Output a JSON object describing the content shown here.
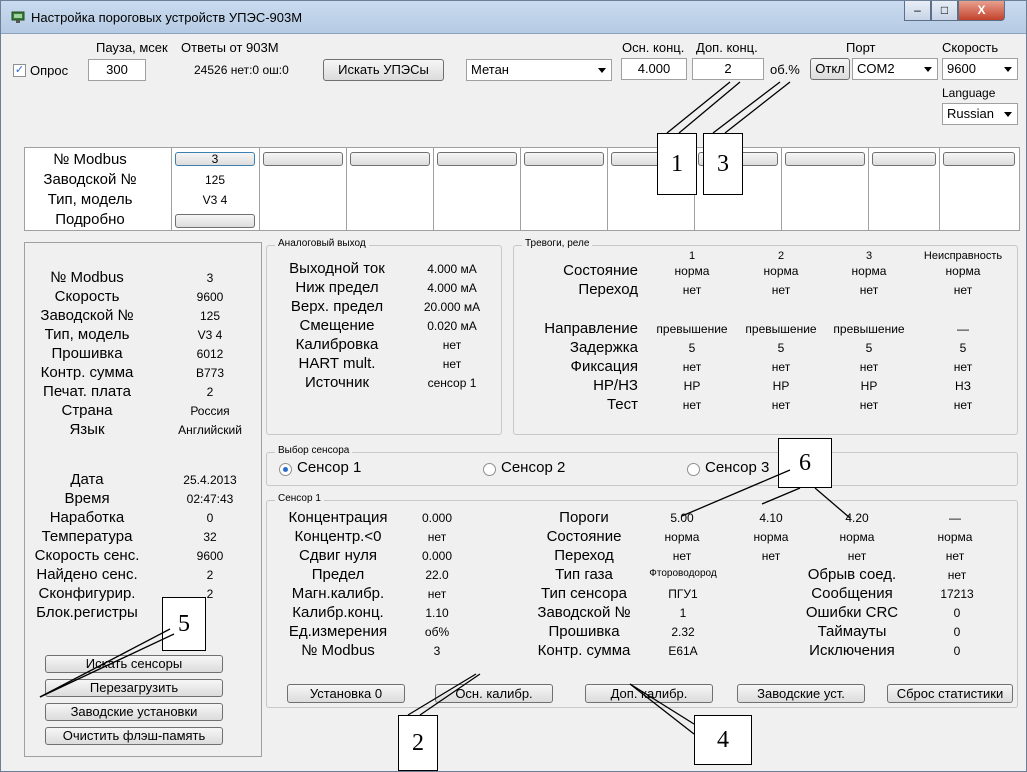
{
  "window": {
    "title": "Настройка пороговых устройств УПЭС-903М"
  },
  "toolbar": {
    "poll_label": "Опрос",
    "pause_label": "Пауза, мсек",
    "pause_value": "300",
    "answers_label": "Ответы от 903М",
    "answers_value": "24526 нет:0 ош:0",
    "search_button": "Искать УПЭСы",
    "gas_select": "Метан",
    "main_conc_label": "Осн. конц.",
    "main_conc_value": "4.000",
    "add_conc_label": "Доп. конц.",
    "add_conc_value": "2",
    "unit": "об.%",
    "off_button": "Откл",
    "port_label": "Порт",
    "port_value": "COM2",
    "speed_label": "Скорость",
    "speed_value": "9600",
    "language_label": "Language",
    "language_value": "Russian"
  },
  "devices": {
    "labels": [
      "№ Modbus",
      "Заводской №",
      "Тип, модель",
      "Подробно"
    ],
    "first": {
      "modbus": "3",
      "serial": "125",
      "model": "V3 4"
    }
  },
  "info": {
    "rows": [
      {
        "label": "№ Modbus",
        "value": "3"
      },
      {
        "label": "Скорость",
        "value": "9600"
      },
      {
        "label": "Заводской №",
        "value": "125"
      },
      {
        "label": "Тип, модель",
        "value": "V3 4"
      },
      {
        "label": "Прошивка",
        "value": "6012"
      },
      {
        "label": "Контр. сумма",
        "value": "B773"
      },
      {
        "label": "Печат. плата",
        "value": "2"
      },
      {
        "label": "Страна",
        "value": "Россия"
      },
      {
        "label": "Язык",
        "value": "Английский"
      }
    ],
    "rows2": [
      {
        "label": "Дата",
        "value": "25.4.2013"
      },
      {
        "label": "Время",
        "value": "02:47:43"
      },
      {
        "label": "Наработка",
        "value": "0"
      },
      {
        "label": "Температура",
        "value": "32"
      },
      {
        "label": "Скорость сенс.",
        "value": "9600"
      },
      {
        "label": "Найдено сенс.",
        "value": "2"
      },
      {
        "label": "Сконфигурир.",
        "value": "2"
      },
      {
        "label": "Блок.регистры",
        "value": ""
      }
    ],
    "buttons": [
      "Искать сенсоры",
      "Перезагрузить",
      "Заводские установки",
      "Очистить флэш-память"
    ]
  },
  "analog": {
    "legend": "Аналоговый выход",
    "rows": [
      {
        "label": "Выходной ток",
        "value": "4.000 мА"
      },
      {
        "label": "Ниж предел",
        "value": "4.000 мА"
      },
      {
        "label": "Верх. предел",
        "value": "20.000 мА"
      },
      {
        "label": "Смещение",
        "value": "0.020 мА"
      },
      {
        "label": "Калибровка",
        "value": "нет"
      },
      {
        "label": "HART mult.",
        "value": "нет"
      },
      {
        "label": "Источник",
        "value": "сенсор 1"
      }
    ]
  },
  "alarms": {
    "legend": "Тревоги, реле",
    "headers": [
      "1",
      "2",
      "3",
      "Неисправность"
    ],
    "rows": [
      {
        "label": "Состояние",
        "values": [
          "норма",
          "норма",
          "норма",
          "норма"
        ]
      },
      {
        "label": "Переход",
        "values": [
          "нет",
          "нет",
          "нет",
          "нет"
        ]
      },
      {
        "label": "Направление",
        "values": [
          "превышение",
          "превышение",
          "превышение",
          "—"
        ]
      },
      {
        "label": "Задержка",
        "values": [
          "5",
          "5",
          "5",
          "5"
        ]
      },
      {
        "label": "Фиксация",
        "values": [
          "нет",
          "нет",
          "нет",
          "нет"
        ]
      },
      {
        "label": "НР/НЗ",
        "values": [
          "НР",
          "НР",
          "НР",
          "НЗ"
        ]
      },
      {
        "label": "Тест",
        "values": [
          "нет",
          "нет",
          "нет",
          "нет"
        ]
      }
    ]
  },
  "sensor_select": {
    "legend": "Выбор сенсора",
    "options": [
      "Сенсор 1",
      "Сенсор 2",
      "Сенсор 3"
    ]
  },
  "sensor1": {
    "legend": "Сенсор 1",
    "left": [
      {
        "label": "Концентрация",
        "value": "0.000"
      },
      {
        "label": "Концентр.<0",
        "value": "нет"
      },
      {
        "label": "Сдвиг нуля",
        "value": "0.000"
      },
      {
        "label": "Предел",
        "value": "22.0"
      },
      {
        "label": "Магн.калибр.",
        "value": "нет"
      },
      {
        "label": "Калибр.конц.",
        "value": "1.10"
      },
      {
        "label": "Ед.измерения",
        "value": "об%"
      },
      {
        "label": "№ Modbus",
        "value": "3"
      }
    ],
    "thresholds_label": "Пороги",
    "thresholds": [
      "5.00",
      "4.10",
      "4.20",
      "—"
    ],
    "state_label": "Состояние",
    "state": [
      "норма",
      "норма",
      "норма",
      "норма"
    ],
    "transition_label": "Переход",
    "transition": [
      "нет",
      "нет",
      "нет",
      "нет"
    ],
    "mid": [
      {
        "label": "Тип газа",
        "value": "Фтороводород"
      },
      {
        "label": "Тип сенсора",
        "value": "ПГУ1"
      },
      {
        "label": "Заводской №",
        "value": "1"
      },
      {
        "label": "Прошивка",
        "value": "2.32"
      },
      {
        "label": "Контр. сумма",
        "value": "E61A"
      }
    ],
    "right": [
      {
        "label": "Обрыв соед.",
        "value": "нет"
      },
      {
        "label": "Сообщения",
        "value": "17213"
      },
      {
        "label": "Ошибки CRC",
        "value": "0"
      },
      {
        "label": "Таймауты",
        "value": "0"
      },
      {
        "label": "Исключения",
        "value": "0"
      }
    ],
    "buttons": [
      "Установка 0",
      "Осн. калибр.",
      "Доп. калибр.",
      "Заводские уст.",
      "Сброс статистики"
    ]
  },
  "callouts": [
    "1",
    "2",
    "3",
    "4",
    "5",
    "6"
  ]
}
